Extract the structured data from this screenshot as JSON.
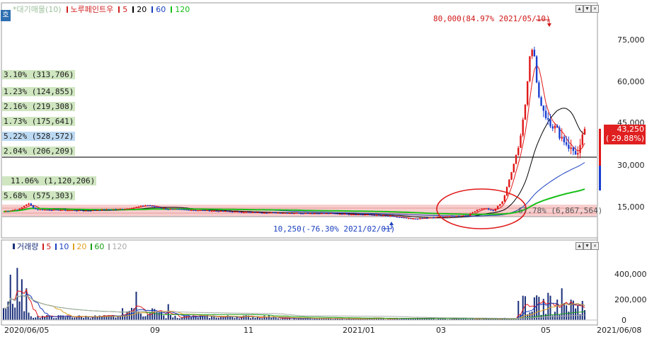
{
  "top_legend": {
    "mode_button": "호",
    "items": [
      {
        "text": "*대기매물(10)",
        "color": "#9bbf9b"
      },
      {
        "text": "노루페인트우",
        "color": "#d02020",
        "marker": "#d02020"
      },
      {
        "text": "5",
        "color": "#d02020",
        "marker": "#d02020"
      },
      {
        "text": "20",
        "color": "#000000",
        "marker": "#000000"
      },
      {
        "text": "60",
        "color": "#1a3fbf",
        "marker": "#1a3fbf"
      },
      {
        "text": "120",
        "color": "#18c018",
        "marker": "#18c018"
      }
    ]
  },
  "volume_profile_labels": [
    {
      "text": "3.10% (313,706)",
      "bg": "#cfe6c0"
    },
    {
      "text": "1.23% (124,855)",
      "bg": "#cfe6c0"
    },
    {
      "text": "2.16% (219,308)",
      "bg": "#cfe6c0"
    },
    {
      "text": "1.73% (175,641)",
      "bg": "#cfe6c0"
    },
    {
      "text": "5.22% (528,572)",
      "bg": "#bcd9f2"
    },
    {
      "text": "2.04% (206,209)",
      "bg": "#cfe6c0"
    },
    {
      "text": "11.06% (1,120,206)",
      "bg": "#cfe6c0"
    },
    {
      "text": "5.68% (575,303)",
      "bg": "#cfe6c0"
    },
    {
      "text": "67.78% (6,867,564)",
      "bg": "#f2c8c8"
    }
  ],
  "annotations": {
    "high": "80,000(84.97% 2021/05/10)",
    "low": "10,250(-76.30% 2021/02/01)"
  },
  "price_axis": {
    "ticks": [
      "75,000",
      "60,000",
      "45,000",
      "30,000",
      "15,000"
    ],
    "current_price": "43,250",
    "current_change": "( 29.88%)",
    "current_color": "#e02020"
  },
  "volume_legend": {
    "items": [
      {
        "text": "거래량",
        "color": "#1a2f7a",
        "marker": "#1a2f7a"
      },
      {
        "text": "5",
        "color": "#d02020",
        "marker": "#d02020"
      },
      {
        "text": "10",
        "color": "#1a3fbf",
        "marker": "#1a3fbf"
      },
      {
        "text": "20",
        "color": "#e0a020",
        "marker": "#e0a020"
      },
      {
        "text": "60",
        "color": "#18a018",
        "marker": "#18a018"
      },
      {
        "text": "120",
        "color": "#aaaaaa",
        "marker": "#aaaaaa"
      }
    ]
  },
  "volume_axis": {
    "ticks": [
      "400,000",
      "200,000",
      "0"
    ]
  },
  "date_axis": {
    "ticks": [
      "2020/06/05",
      "09",
      "11",
      "2021/01",
      "03",
      "05",
      "2021/06/08"
    ]
  },
  "chart_data": {
    "type": "candlestick",
    "title": "노루페인트우",
    "price_range": [
      5000,
      85000
    ],
    "high": 80000,
    "high_date": "2021/05/10",
    "low": 10250,
    "low_date": "2021/02/01",
    "last_price": 43250,
    "last_change_pct": 29.88,
    "moving_averages": [
      5,
      20,
      60,
      120
    ],
    "price_series_approx": {
      "dates": [
        "2020/06/05",
        "2020/07",
        "2020/08",
        "2020/09",
        "2020/10",
        "2020/11",
        "2020/12",
        "2021/01",
        "2021/02",
        "2021/03",
        "2021/04/01",
        "2021/04/20",
        "2021/05/01",
        "2021/05/10",
        "2021/05/20",
        "2021/06/01",
        "2021/06/08"
      ],
      "close": [
        13500,
        14000,
        13500,
        15500,
        14500,
        13500,
        12800,
        12000,
        10500,
        11500,
        12500,
        16000,
        28000,
        72000,
        47000,
        36000,
        43250
      ]
    },
    "volume_range": [
      0,
      480000
    ],
    "volume_series_approx": {
      "dates": [
        "2020/06/05",
        "2020/06/15",
        "2020/06/20",
        "2020/09",
        "2020/10",
        "2020/11",
        "2021/01",
        "2021/03",
        "2021/04/20",
        "2021/05/01",
        "2021/05/10",
        "2021/06/08"
      ],
      "volume": [
        380000,
        460000,
        360000,
        250000,
        120000,
        60000,
        40000,
        35000,
        210000,
        240000,
        280000,
        70000
      ]
    },
    "volume_profile": [
      {
        "pct": 3.1,
        "volume": 313706
      },
      {
        "pct": 1.23,
        "volume": 124855
      },
      {
        "pct": 2.16,
        "volume": 219308
      },
      {
        "pct": 1.73,
        "volume": 175641
      },
      {
        "pct": 5.22,
        "volume": 528572
      },
      {
        "pct": 2.04,
        "volume": 206209
      },
      {
        "pct": 11.06,
        "volume": 1120206
      },
      {
        "pct": 5.68,
        "volume": 575303
      },
      {
        "pct": 67.78,
        "volume": 6867564
      }
    ]
  }
}
